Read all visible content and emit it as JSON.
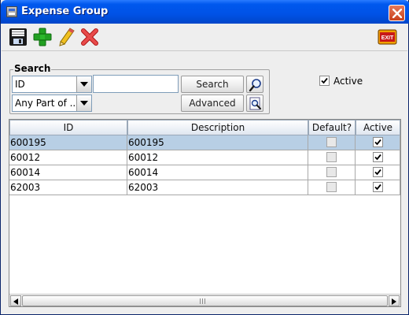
{
  "window": {
    "title": "Expense Group"
  },
  "toolbar": {
    "buttons": [
      {
        "name": "save",
        "icon": "save-icon"
      },
      {
        "name": "add",
        "icon": "plus-icon"
      },
      {
        "name": "edit",
        "icon": "pencil-icon"
      },
      {
        "name": "delete",
        "icon": "red-x-icon"
      },
      {
        "name": "exit",
        "icon": "exit-icon",
        "label": "EXIT"
      }
    ]
  },
  "search": {
    "legend": "Search",
    "field_select": "ID",
    "match_select": "Any Part of ...",
    "query_value": "",
    "search_label": "Search",
    "advanced_label": "Advanced"
  },
  "filters": {
    "active_label": "Active",
    "active_checked": true
  },
  "table": {
    "columns": [
      "ID",
      "Description",
      "Default?",
      "Active"
    ],
    "rows": [
      {
        "id": "600195",
        "description": "600195",
        "default": false,
        "active": true,
        "selected": true
      },
      {
        "id": "60012",
        "description": "60012",
        "default": false,
        "active": true,
        "selected": false
      },
      {
        "id": "60014",
        "description": "60014",
        "default": false,
        "active": true,
        "selected": false
      },
      {
        "id": "62003",
        "description": "62003",
        "default": false,
        "active": true,
        "selected": false
      }
    ]
  },
  "colors": {
    "titlebar": "#0054e3",
    "selected_row": "#b8cfe5",
    "add_green": "#22a022",
    "delete_red": "#e23a3a"
  }
}
